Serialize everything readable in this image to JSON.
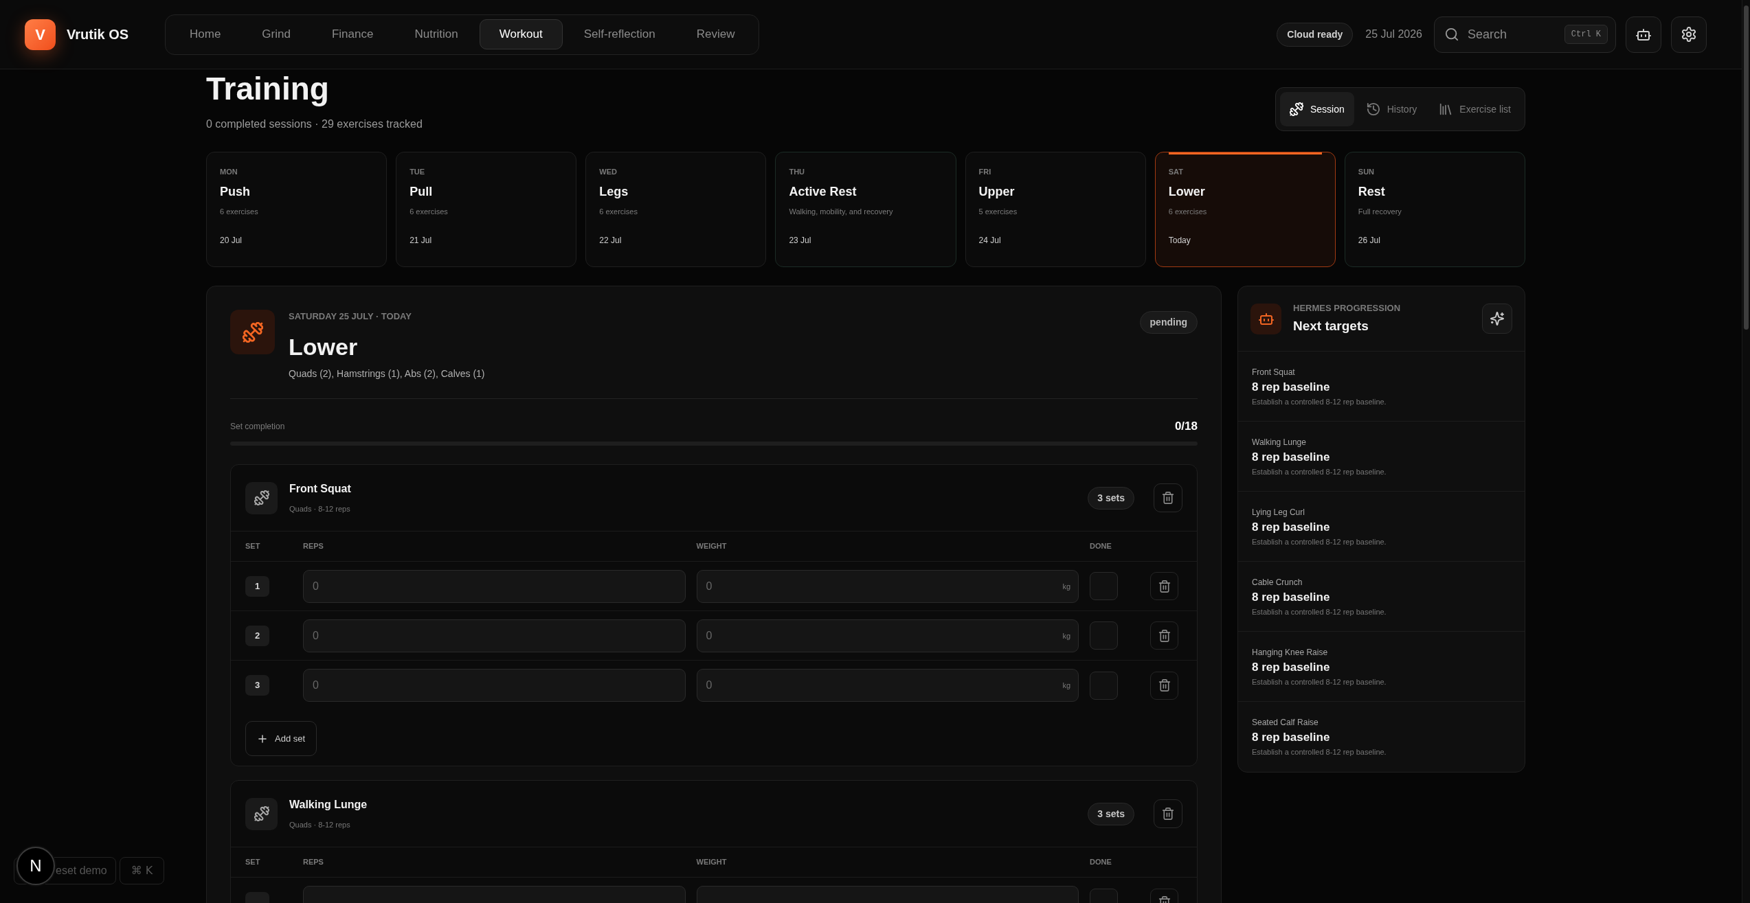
{
  "app": {
    "logo_letter": "V",
    "name": "Vrutik OS"
  },
  "nav": [
    {
      "label": "Home",
      "selected": false
    },
    {
      "label": "Grind",
      "selected": false
    },
    {
      "label": "Finance",
      "selected": false
    },
    {
      "label": "Nutrition",
      "selected": false
    },
    {
      "label": "Workout",
      "selected": true
    },
    {
      "label": "Self-reflection",
      "selected": false
    },
    {
      "label": "Review",
      "selected": false
    }
  ],
  "header": {
    "status_badge": "Cloud ready",
    "date": "25 Jul 2026",
    "search": {
      "placeholder": "Search",
      "shortcut": "Ctrl K"
    }
  },
  "page": {
    "title": "Training",
    "subtitle": "0 completed sessions · 29 exercises tracked"
  },
  "view_tabs": [
    {
      "label": "Session",
      "kind": "session",
      "selected": true
    },
    {
      "label": "History",
      "kind": "history",
      "selected": false
    },
    {
      "label": "Exercise list",
      "kind": "catalog",
      "selected": false
    }
  ],
  "week": [
    {
      "day": "MON",
      "title": "Push",
      "detail": "6 exercises",
      "date": "20 Jul",
      "kind": "training",
      "selected": false
    },
    {
      "day": "TUE",
      "title": "Pull",
      "detail": "6 exercises",
      "date": "21 Jul",
      "kind": "training",
      "selected": false
    },
    {
      "day": "WED",
      "title": "Legs",
      "detail": "6 exercises",
      "date": "22 Jul",
      "kind": "training",
      "selected": false
    },
    {
      "day": "THU",
      "title": "Active Rest",
      "detail": "Walking, mobility, and recovery",
      "date": "23 Jul",
      "kind": "rest",
      "selected": false
    },
    {
      "day": "FRI",
      "title": "Upper",
      "detail": "5 exercises",
      "date": "24 Jul",
      "kind": "training",
      "selected": false
    },
    {
      "day": "SAT",
      "title": "Lower",
      "detail": "6 exercises",
      "date": "Today",
      "kind": "training",
      "selected": true
    },
    {
      "day": "SUN",
      "title": "Rest",
      "detail": "Full recovery",
      "date": "26 Jul",
      "kind": "rest",
      "selected": false
    }
  ],
  "session": {
    "eyebrow": "SATURDAY 25 JULY · TODAY",
    "title": "Lower",
    "muscles": "Quads (2), Hamstrings (1), Abs (2), Calves (1)",
    "status": "pending",
    "progress": {
      "label": "Set completion",
      "count": "0/18",
      "level": 0
    },
    "exercises": [
      {
        "name": "Front Squat",
        "detail": "Quads · 8-12 reps",
        "sets_badge": "3 sets",
        "columns": [
          "SET",
          "REPS",
          "WEIGHT",
          "DONE"
        ],
        "sets": [
          {
            "number": "1",
            "reps_placeholder": "0",
            "weight_placeholder": "0",
            "unit": "kg",
            "done": false
          },
          {
            "number": "2",
            "reps_placeholder": "0",
            "weight_placeholder": "0",
            "unit": "kg",
            "done": false
          },
          {
            "number": "3",
            "reps_placeholder": "0",
            "weight_placeholder": "0",
            "unit": "kg",
            "done": false
          }
        ],
        "add_label": "Add set"
      },
      {
        "name": "Walking Lunge",
        "detail": "Quads · 8-12 reps",
        "sets_badge": "3 sets",
        "columns": [
          "SET",
          "REPS",
          "WEIGHT",
          "DONE"
        ],
        "sets": [
          {
            "done": false
          }
        ]
      }
    ]
  },
  "progression": {
    "eyebrow": "HERMES PROGRESSION",
    "title": "Next targets",
    "items": [
      {
        "exercise": "Front Squat",
        "target": "8 rep baseline",
        "note": "Establish a controlled 8-12 rep baseline."
      },
      {
        "exercise": "Walking Lunge",
        "target": "8 rep baseline",
        "note": "Establish a controlled 8-12 rep baseline."
      },
      {
        "exercise": "Lying Leg Curl",
        "target": "8 rep baseline",
        "note": "Establish a controlled 8-12 rep baseline."
      },
      {
        "exercise": "Cable Crunch",
        "target": "8 rep baseline",
        "note": "Establish a controlled 8-12 rep baseline."
      },
      {
        "exercise": "Hanging Knee Raise",
        "target": "8 rep baseline",
        "note": "Establish a controlled 8-12 rep baseline."
      },
      {
        "exercise": "Seated Calf Raise",
        "target": "8 rep baseline",
        "note": "Establish a controlled 8-12 rep baseline."
      }
    ]
  },
  "dev_tools": {
    "indicator": "N",
    "reset_label": "eset demo",
    "shortcut": "⌘ K"
  }
}
